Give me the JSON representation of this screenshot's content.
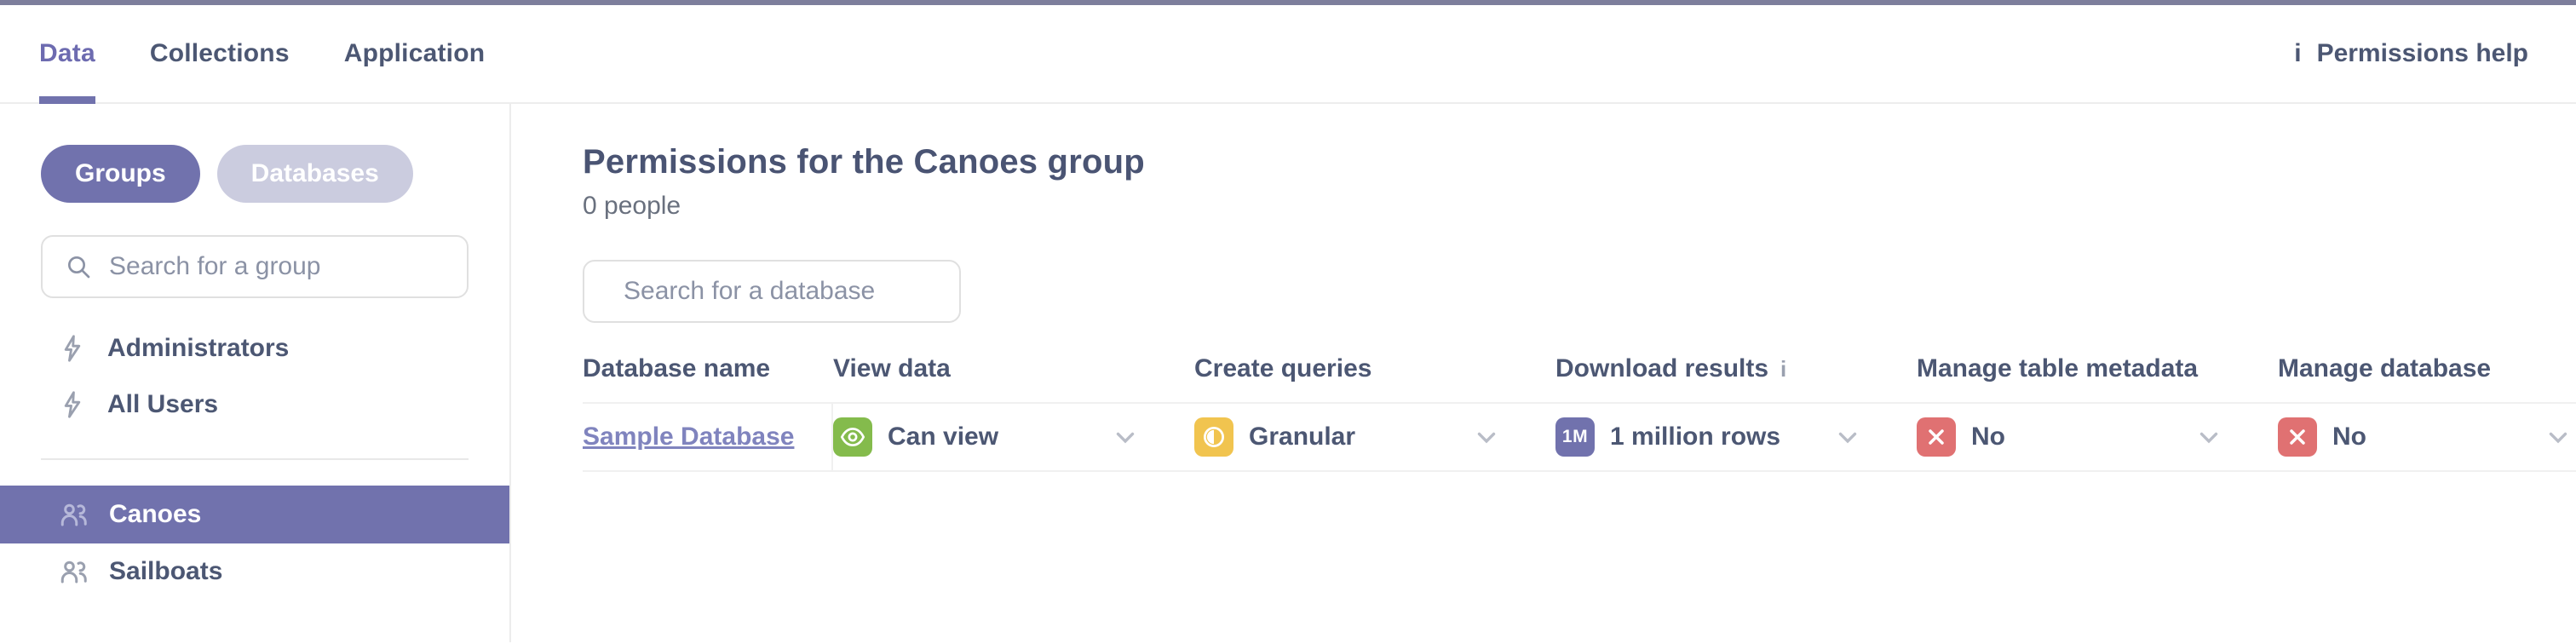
{
  "topnav": {
    "tabs": [
      {
        "label": "Data",
        "active": true
      },
      {
        "label": "Collections",
        "active": false
      },
      {
        "label": "Application",
        "active": false
      }
    ],
    "help_label": "Permissions help"
  },
  "icons": {
    "info_glyph": "i"
  },
  "sidebar": {
    "view_toggle": [
      {
        "label": "Groups",
        "active": true
      },
      {
        "label": "Databases",
        "active": false
      }
    ],
    "search_placeholder": "Search for a group",
    "default_groups": [
      {
        "label": "Administrators",
        "icon": "bolt-icon"
      },
      {
        "label": "All Users",
        "icon": "bolt-icon"
      }
    ],
    "custom_groups": [
      {
        "label": "Canoes",
        "icon": "group-icon",
        "selected": true
      },
      {
        "label": "Sailboats",
        "icon": "group-icon",
        "selected": false
      }
    ]
  },
  "main": {
    "title": "Permissions for the Canoes group",
    "subtitle": "0 people",
    "search_placeholder": "Search for a database",
    "table": {
      "columns": [
        "Database name",
        "View data",
        "Create queries",
        "Download results",
        "Manage table metadata",
        "Manage database"
      ],
      "row": {
        "name": "Sample Database",
        "permissions": [
          {
            "column": "View data",
            "value": "Can view",
            "icon": "eye-icon",
            "color": "#84BB4C"
          },
          {
            "column": "Create queries",
            "value": "Granular",
            "icon": "contrast-icon",
            "color": "#F1C44F"
          },
          {
            "column": "Download results",
            "value": "1 million rows",
            "icon": "1m-badge",
            "badge_label": "1M",
            "color": "#7172AD"
          },
          {
            "column": "Manage table metadata",
            "value": "No",
            "icon": "close-icon",
            "color": "#E07172"
          },
          {
            "column": "Manage database",
            "value": "No",
            "icon": "close-icon",
            "color": "#E07172"
          }
        ]
      }
    }
  },
  "colors": {
    "accent_purple": "#7172AD",
    "active_tab": "#6D6BB0",
    "inactive_pill": "#CBCCDF",
    "text_dark": "#4C5773",
    "text_gray": "#69707E",
    "link_purple": "#8084BE",
    "success_green": "#84BB4C",
    "warning_yellow": "#F1C44F",
    "error_red": "#E07172",
    "top_strip": "#7D7E9C",
    "border": "#F0F0F0"
  }
}
